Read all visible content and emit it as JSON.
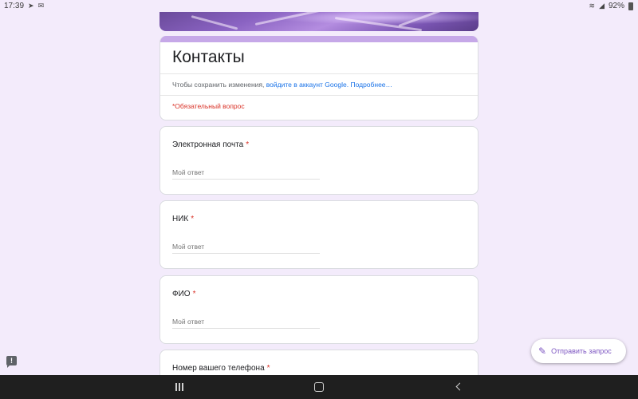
{
  "status_bar": {
    "time": "17:39",
    "battery": "92%"
  },
  "form": {
    "title": "Контакты",
    "signin_prefix": "Чтобы сохранить изменения, ",
    "signin_link": "войдите в аккаунт Google.",
    "learn_more": "Подробнее…",
    "required_note": "*Обязательный вопрос",
    "questions": [
      {
        "label": "Электронная почта",
        "required_mark": "*",
        "placeholder": "Мой ответ"
      },
      {
        "label": "НИК",
        "required_mark": "*",
        "placeholder": "Мой ответ"
      },
      {
        "label": "ФИО",
        "required_mark": "*",
        "placeholder": "Мой ответ"
      },
      {
        "label": "Номер вашего телефона",
        "required_mark": "*"
      }
    ]
  },
  "fab": {
    "label": "Отправить запрос",
    "icon": "pencil-icon"
  },
  "feedback": {
    "icon": "feedback-icon",
    "glyph": "!"
  },
  "colors": {
    "background": "#f3ebfb",
    "accent": "#c6a8e8",
    "fab_text": "#7e57c2",
    "required": "#d93025",
    "link": "#1a73e8"
  }
}
